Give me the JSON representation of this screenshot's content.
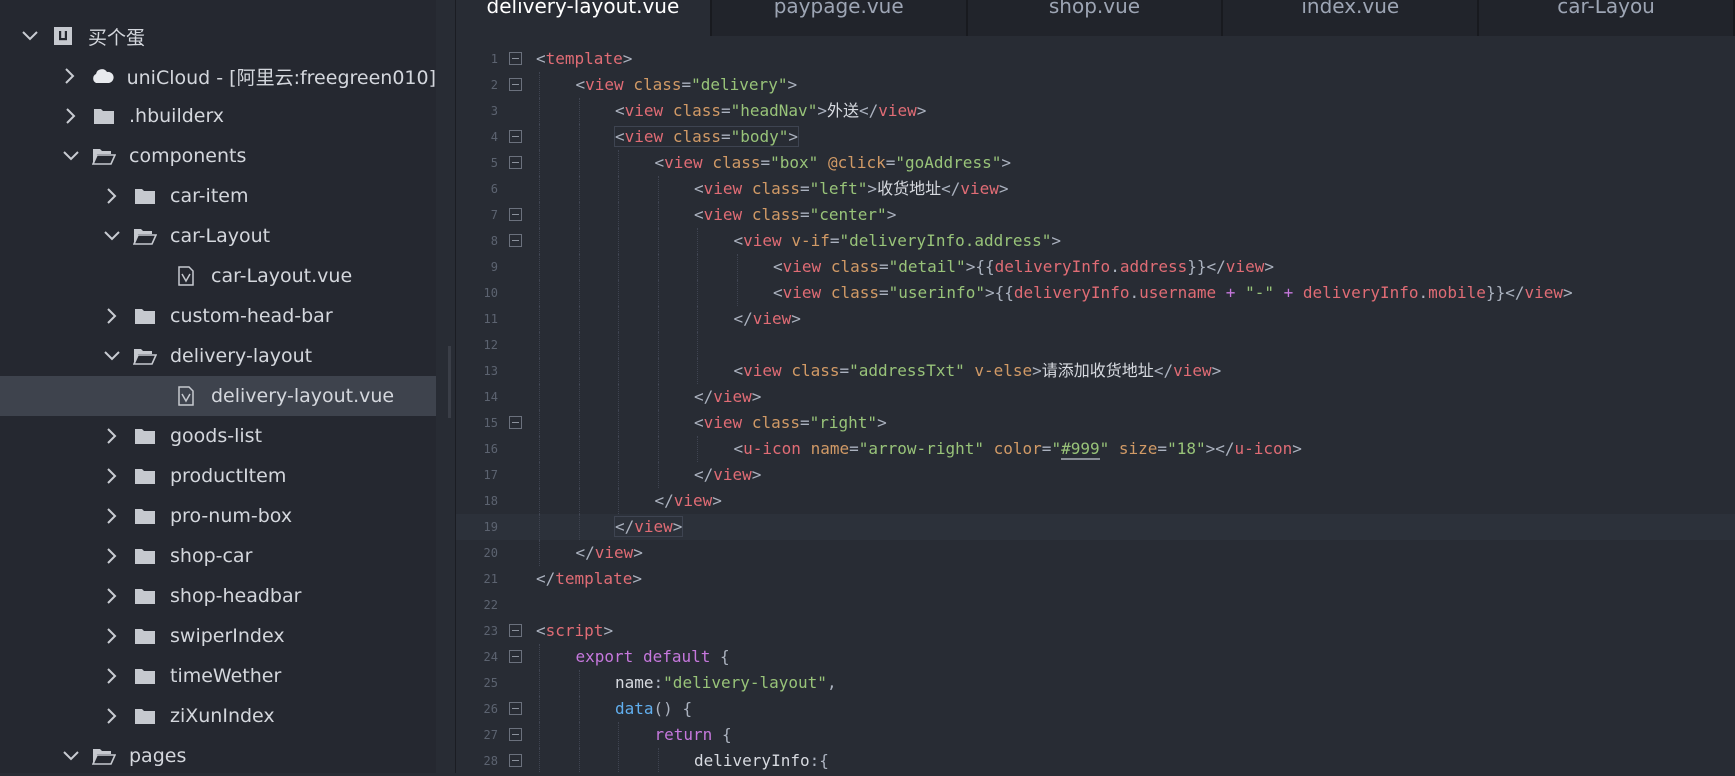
{
  "sidebar": {
    "items": [
      {
        "label": "买个蛋",
        "kind": "project",
        "level": 0,
        "expanded": true
      },
      {
        "label": "uniCloud - [阿里云:freegreen010]",
        "kind": "cloud",
        "level": 1,
        "expanded": false
      },
      {
        "label": ".hbuilderx",
        "kind": "folder",
        "level": 1,
        "expanded": false
      },
      {
        "label": "components",
        "kind": "folder",
        "level": 1,
        "expanded": true
      },
      {
        "label": "car-item",
        "kind": "folder",
        "level": 2,
        "expanded": false
      },
      {
        "label": "car-Layout",
        "kind": "folder",
        "level": 2,
        "expanded": true
      },
      {
        "label": "car-Layout.vue",
        "kind": "file",
        "level": 3
      },
      {
        "label": "custom-head-bar",
        "kind": "folder",
        "level": 2,
        "expanded": false
      },
      {
        "label": "delivery-layout",
        "kind": "folder",
        "level": 2,
        "expanded": true
      },
      {
        "label": "delivery-layout.vue",
        "kind": "file",
        "level": 3,
        "selected": true
      },
      {
        "label": "goods-list",
        "kind": "folder",
        "level": 2,
        "expanded": false
      },
      {
        "label": "productItem",
        "kind": "folder",
        "level": 2,
        "expanded": false
      },
      {
        "label": "pro-num-box",
        "kind": "folder",
        "level": 2,
        "expanded": false
      },
      {
        "label": "shop-car",
        "kind": "folder",
        "level": 2,
        "expanded": false
      },
      {
        "label": "shop-headbar",
        "kind": "folder",
        "level": 2,
        "expanded": false
      },
      {
        "label": "swiperIndex",
        "kind": "folder",
        "level": 2,
        "expanded": false
      },
      {
        "label": "timeWether",
        "kind": "folder",
        "level": 2,
        "expanded": false
      },
      {
        "label": "ziXunIndex",
        "kind": "folder",
        "level": 2,
        "expanded": false
      },
      {
        "label": "pages",
        "kind": "folder",
        "level": 1,
        "expanded": true
      }
    ]
  },
  "tabs": [
    {
      "label": "delivery-layout.vue",
      "active": true
    },
    {
      "label": "paypage.vue",
      "active": false
    },
    {
      "label": "shop.vue",
      "active": false
    },
    {
      "label": "index.vue",
      "active": false
    },
    {
      "label": "car-Layou",
      "active": false
    }
  ],
  "editor": {
    "current_line": 19,
    "lines": [
      {
        "n": "1",
        "fold": true,
        "indent": 0,
        "tokens": [
          [
            "b",
            "<"
          ],
          [
            "tag",
            "template"
          ],
          [
            "b",
            ">"
          ]
        ]
      },
      {
        "n": "2",
        "fold": true,
        "indent": 1,
        "tokens": [
          [
            "b",
            "<"
          ],
          [
            "tag",
            "view"
          ],
          [
            "text",
            " "
          ],
          [
            "attr",
            "class"
          ],
          [
            "b",
            "="
          ],
          [
            "str",
            "\"delivery\""
          ],
          [
            "b",
            ">"
          ]
        ]
      },
      {
        "n": "3",
        "fold": false,
        "indent": 2,
        "tokens": [
          [
            "b",
            "<"
          ],
          [
            "tag",
            "view"
          ],
          [
            "text",
            " "
          ],
          [
            "attr",
            "class"
          ],
          [
            "b",
            "="
          ],
          [
            "str",
            "\"headNav\""
          ],
          [
            "b",
            ">"
          ],
          [
            "text",
            "外送"
          ],
          [
            "b",
            "</"
          ],
          [
            "tag",
            "view"
          ],
          [
            "b",
            ">"
          ]
        ]
      },
      {
        "n": "4",
        "fold": true,
        "indent": 2,
        "boxed": true,
        "tokens": [
          [
            "b",
            "<"
          ],
          [
            "tag",
            "view"
          ],
          [
            "text",
            " "
          ],
          [
            "attr",
            "class"
          ],
          [
            "b",
            "="
          ],
          [
            "str",
            "\"body\""
          ],
          [
            "b",
            ">"
          ]
        ]
      },
      {
        "n": "5",
        "fold": true,
        "indent": 3,
        "tokens": [
          [
            "b",
            "<"
          ],
          [
            "tag",
            "view"
          ],
          [
            "text",
            " "
          ],
          [
            "attr",
            "class"
          ],
          [
            "b",
            "="
          ],
          [
            "str",
            "\"box\""
          ],
          [
            "text",
            " "
          ],
          [
            "attr",
            "@click"
          ],
          [
            "b",
            "="
          ],
          [
            "str",
            "\"goAddress\""
          ],
          [
            "b",
            ">"
          ]
        ]
      },
      {
        "n": "6",
        "fold": false,
        "indent": 4,
        "tokens": [
          [
            "b",
            "<"
          ],
          [
            "tag",
            "view"
          ],
          [
            "text",
            " "
          ],
          [
            "attr",
            "class"
          ],
          [
            "b",
            "="
          ],
          [
            "str",
            "\"left\""
          ],
          [
            "b",
            ">"
          ],
          [
            "text",
            "收货地址"
          ],
          [
            "b",
            "</"
          ],
          [
            "tag",
            "view"
          ],
          [
            "b",
            ">"
          ]
        ]
      },
      {
        "n": "7",
        "fold": true,
        "indent": 4,
        "tokens": [
          [
            "b",
            "<"
          ],
          [
            "tag",
            "view"
          ],
          [
            "text",
            " "
          ],
          [
            "attr",
            "class"
          ],
          [
            "b",
            "="
          ],
          [
            "str",
            "\"center\""
          ],
          [
            "b",
            ">"
          ]
        ]
      },
      {
        "n": "8",
        "fold": true,
        "indent": 5,
        "tokens": [
          [
            "b",
            "<"
          ],
          [
            "tag",
            "view"
          ],
          [
            "text",
            " "
          ],
          [
            "attr",
            "v-if"
          ],
          [
            "b",
            "="
          ],
          [
            "str",
            "\"deliveryInfo.address\""
          ],
          [
            "b",
            ">"
          ]
        ]
      },
      {
        "n": "9",
        "fold": false,
        "indent": 6,
        "tokens": [
          [
            "b",
            "<"
          ],
          [
            "tag",
            "view"
          ],
          [
            "text",
            " "
          ],
          [
            "attr",
            "class"
          ],
          [
            "b",
            "="
          ],
          [
            "str",
            "\"detail\""
          ],
          [
            "b",
            ">"
          ],
          [
            "b",
            "{{"
          ],
          [
            "var",
            "deliveryInfo"
          ],
          [
            "b",
            "."
          ],
          [
            "var",
            "address"
          ],
          [
            "b",
            "}}"
          ],
          [
            "b",
            "</"
          ],
          [
            "tag",
            "view"
          ],
          [
            "b",
            ">"
          ]
        ]
      },
      {
        "n": "10",
        "fold": false,
        "indent": 6,
        "tokens": [
          [
            "b",
            "<"
          ],
          [
            "tag",
            "view"
          ],
          [
            "text",
            " "
          ],
          [
            "attr",
            "class"
          ],
          [
            "b",
            "="
          ],
          [
            "str",
            "\"userinfo\""
          ],
          [
            "b",
            ">"
          ],
          [
            "b",
            "{{"
          ],
          [
            "var",
            "deliveryInfo"
          ],
          [
            "b",
            "."
          ],
          [
            "var",
            "username"
          ],
          [
            "text",
            " "
          ],
          [
            "op",
            "+"
          ],
          [
            "text",
            " "
          ],
          [
            "str",
            "\"-\""
          ],
          [
            "text",
            " "
          ],
          [
            "op",
            "+"
          ],
          [
            "text",
            " "
          ],
          [
            "var",
            "deliveryInfo"
          ],
          [
            "b",
            "."
          ],
          [
            "var",
            "mobile"
          ],
          [
            "b",
            "}}"
          ],
          [
            "b",
            "</"
          ],
          [
            "tag",
            "view"
          ],
          [
            "b",
            ">"
          ]
        ]
      },
      {
        "n": "11",
        "fold": false,
        "indent": 5,
        "tokens": [
          [
            "b",
            "</"
          ],
          [
            "tag",
            "view"
          ],
          [
            "b",
            ">"
          ]
        ]
      },
      {
        "n": "12",
        "fold": false,
        "indent": 5,
        "tokens": []
      },
      {
        "n": "13",
        "fold": false,
        "indent": 5,
        "tokens": [
          [
            "b",
            "<"
          ],
          [
            "tag",
            "view"
          ],
          [
            "text",
            " "
          ],
          [
            "attr",
            "class"
          ],
          [
            "b",
            "="
          ],
          [
            "str",
            "\"addressTxt\""
          ],
          [
            "text",
            " "
          ],
          [
            "attr",
            "v-else"
          ],
          [
            "b",
            ">"
          ],
          [
            "text",
            "请添加收货地址"
          ],
          [
            "b",
            "</"
          ],
          [
            "tag",
            "view"
          ],
          [
            "b",
            ">"
          ]
        ]
      },
      {
        "n": "14",
        "fold": false,
        "indent": 4,
        "tokens": [
          [
            "b",
            "</"
          ],
          [
            "tag",
            "view"
          ],
          [
            "b",
            ">"
          ]
        ]
      },
      {
        "n": "15",
        "fold": true,
        "indent": 4,
        "tokens": [
          [
            "b",
            "<"
          ],
          [
            "tag",
            "view"
          ],
          [
            "text",
            " "
          ],
          [
            "attr",
            "class"
          ],
          [
            "b",
            "="
          ],
          [
            "str",
            "\"right\""
          ],
          [
            "b",
            ">"
          ]
        ]
      },
      {
        "n": "16",
        "fold": false,
        "indent": 5,
        "tokens": [
          [
            "b",
            "<"
          ],
          [
            "tag",
            "u-icon"
          ],
          [
            "text",
            " "
          ],
          [
            "attr",
            "name"
          ],
          [
            "b",
            "="
          ],
          [
            "str",
            "\"arrow-right\""
          ],
          [
            "text",
            " "
          ],
          [
            "attr",
            "color"
          ],
          [
            "b",
            "="
          ],
          [
            "str",
            "\""
          ],
          [
            "u999",
            "#999"
          ],
          [
            "str",
            "\""
          ],
          [
            "text",
            " "
          ],
          [
            "attr",
            "size"
          ],
          [
            "b",
            "="
          ],
          [
            "str",
            "\"18\""
          ],
          [
            "b",
            ">"
          ],
          [
            "b",
            "</"
          ],
          [
            "tag",
            "u-icon"
          ],
          [
            "b",
            ">"
          ]
        ]
      },
      {
        "n": "17",
        "fold": false,
        "indent": 4,
        "tokens": [
          [
            "b",
            "</"
          ],
          [
            "tag",
            "view"
          ],
          [
            "b",
            ">"
          ]
        ]
      },
      {
        "n": "18",
        "fold": false,
        "indent": 3,
        "tokens": [
          [
            "b",
            "</"
          ],
          [
            "tag",
            "view"
          ],
          [
            "b",
            ">"
          ]
        ]
      },
      {
        "n": "19",
        "fold": false,
        "indent": 2,
        "boxed": true,
        "tokens": [
          [
            "b",
            "</"
          ],
          [
            "tag",
            "view"
          ],
          [
            "b",
            ">"
          ]
        ]
      },
      {
        "n": "20",
        "fold": false,
        "indent": 1,
        "tokens": [
          [
            "b",
            "</"
          ],
          [
            "tag",
            "view"
          ],
          [
            "b",
            ">"
          ]
        ]
      },
      {
        "n": "21",
        "fold": false,
        "indent": 0,
        "tokens": [
          [
            "b",
            "</"
          ],
          [
            "tag",
            "template"
          ],
          [
            "b",
            ">"
          ]
        ]
      },
      {
        "n": "22",
        "fold": false,
        "indent": 0,
        "tokens": []
      },
      {
        "n": "23",
        "fold": true,
        "indent": 0,
        "tokens": [
          [
            "b",
            "<"
          ],
          [
            "tag",
            "script"
          ],
          [
            "b",
            ">"
          ]
        ]
      },
      {
        "n": "24",
        "fold": true,
        "indent": 1,
        "tokens": [
          [
            "kw",
            "export"
          ],
          [
            "text",
            " "
          ],
          [
            "kw",
            "default"
          ],
          [
            "text",
            " "
          ],
          [
            "b",
            "{"
          ]
        ]
      },
      {
        "n": "25",
        "fold": false,
        "indent": 2,
        "tokens": [
          [
            "prop",
            "name"
          ],
          [
            "b",
            ":"
          ],
          [
            "str",
            "\"delivery-layout\""
          ],
          [
            "b",
            ","
          ]
        ]
      },
      {
        "n": "26",
        "fold": true,
        "indent": 2,
        "tokens": [
          [
            "fn",
            "data"
          ],
          [
            "b",
            "()"
          ],
          [
            "text",
            " "
          ],
          [
            "b",
            "{"
          ]
        ]
      },
      {
        "n": "27",
        "fold": true,
        "indent": 3,
        "tokens": [
          [
            "kw",
            "return"
          ],
          [
            "text",
            " "
          ],
          [
            "b",
            "{"
          ]
        ]
      },
      {
        "n": "28",
        "fold": true,
        "indent": 4,
        "tokens": [
          [
            "prop",
            "deliveryInfo"
          ],
          [
            "b",
            ":{"
          ]
        ]
      }
    ]
  },
  "colors": {
    "editor_bg": "#282c34",
    "sidebar_bg": "#252830",
    "selected_row": "#3e434d",
    "tag": "#e06c75",
    "attr": "#d19a66",
    "string": "#98c379",
    "keyword": "#c678dd",
    "function": "#61afef"
  }
}
